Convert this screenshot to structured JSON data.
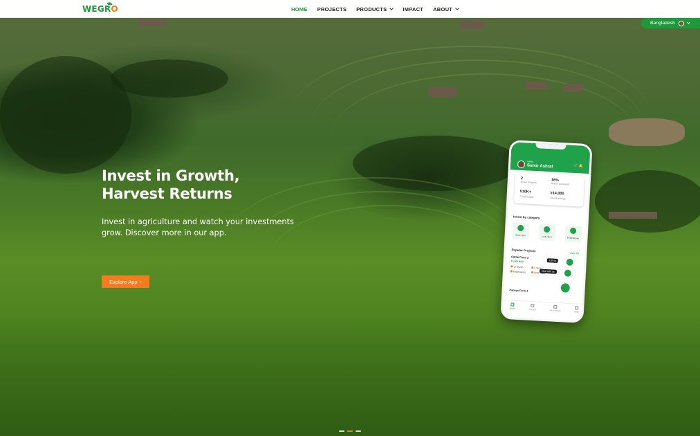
{
  "brand": {
    "logo_part1": "WEGR",
    "logo_part2": "O",
    "brand_color": "#1f9a3a",
    "accent_color": "#f27c1f"
  },
  "nav": {
    "items": [
      {
        "label": "HOME",
        "active": true
      },
      {
        "label": "PROJECTS"
      },
      {
        "label": "PRODUCTS",
        "dropdown": true
      },
      {
        "label": "IMPACT"
      },
      {
        "label": "ABOUT",
        "dropdown": true
      }
    ]
  },
  "country": {
    "label": "Bangladesh",
    "icon": "flag-icon"
  },
  "hero": {
    "title_line1": "Invest in Growth,",
    "title_line2": "Harvest Returns",
    "subtitle_line1": "Invest in agriculture and watch your investments",
    "subtitle_line2": "grow. Discover more in our app.",
    "cta_label": "Explore App",
    "cta_icon": "›"
  },
  "carousel": {
    "slides": 3,
    "active_index": 1
  },
  "phone": {
    "greeting": "Hello!",
    "user_name": "Sumir Ashraf",
    "stats": [
      {
        "value": "2",
        "label": "Active Projects"
      },
      {
        "value": "16%",
        "label": "Return Achieved"
      },
      {
        "value": "৳10K+",
        "label": "Fund Raised"
      },
      {
        "value": "৳14,000",
        "label": "Total Earnings"
      }
    ],
    "invest_by_category": "Invest by category",
    "categories": [
      "Short Term",
      "Long Term",
      "Fixed Return"
    ],
    "popular_projects": "Popular Projects",
    "view_all": "View All",
    "project1_name": "Cattle Farm 2",
    "project1_price": "10,000 BDT",
    "project1_meta": [
      "12 Month",
      "3 Slots",
      "Kishoreganj",
      "6000 Taka"
    ],
    "call_us": "Call us",
    "chat_with_us": "Chat with us",
    "project2_name": "Papaya Farm 4",
    "tabs": [
      "Home",
      "Projects",
      "My Portfolio",
      "More"
    ]
  }
}
